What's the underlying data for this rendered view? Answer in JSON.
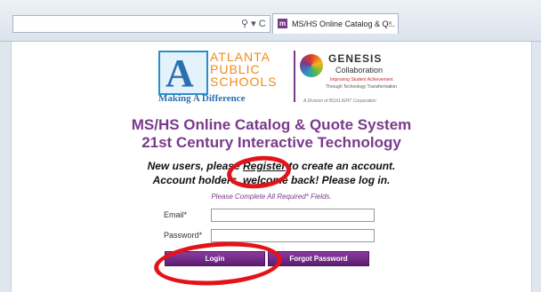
{
  "browser": {
    "addr_controls": "⚲ ▾ C",
    "tab_icon_letter": "m",
    "tab_title": "MS/HS Online Catalog & Q...",
    "tab_close": "×"
  },
  "logo_aps": {
    "letter": "A",
    "line1": "ATLANTA",
    "line2": "PUBLIC",
    "line3": "SCHOOLS",
    "tagline": "Making A Difference"
  },
  "logo_genesis": {
    "title": "GENESIS",
    "subtitle": "Collaboration",
    "tag1": "Improving Student Achievement",
    "tag2": "Through Technology Transformation",
    "tag3": "A Division of BOXLIGHT Corporation"
  },
  "heading": {
    "line1": "MS/HS Online Catalog & Quote System",
    "line2": "21st Century Interactive Technology"
  },
  "message": {
    "line1_pre": "New users, please ",
    "register_link": "Register",
    "line1_post": " to create an account.",
    "line2": "Account holders, welcome back! Please log in."
  },
  "form": {
    "required_note": "Please Complete All Required* Fields.",
    "email_label": "Email*",
    "email_value": "",
    "password_label": "Password*",
    "password_value": "",
    "login_button": "Login",
    "forgot_button": "Forgot Password"
  },
  "colors": {
    "brand_purple": "#7a3a8c",
    "annotation_red": "#e3131a",
    "aps_blue": "#2a6fb0",
    "aps_orange": "#f08a1c"
  }
}
